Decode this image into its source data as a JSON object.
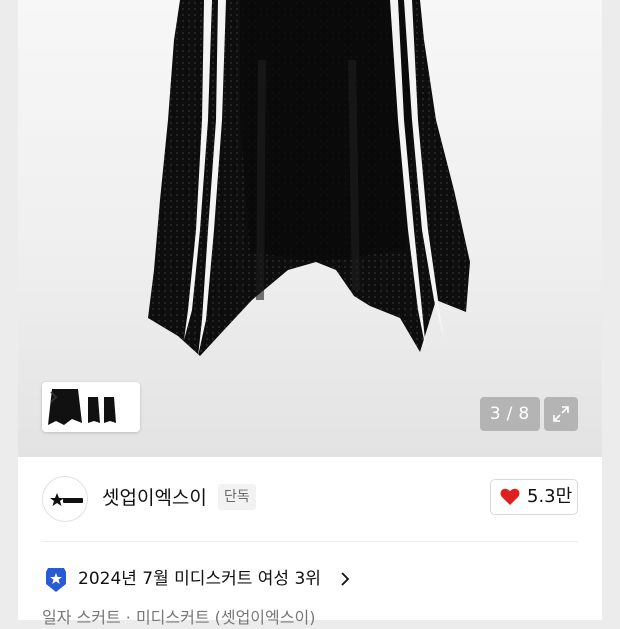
{
  "gallery": {
    "counter_current": "3",
    "counter_separator": "/",
    "counter_total": "8",
    "thumbnails_icon": "skirt-thumbnails",
    "expand_icon": "expand-arrows-icon"
  },
  "brand": {
    "name": "셋업이엑스이",
    "exclusive_label": "단독",
    "logo_icon": "star-logo-icon"
  },
  "like": {
    "count": "5.3만",
    "icon": "heart-icon",
    "color": "#e02020"
  },
  "ranking": {
    "text": "2024년 7월 미디스커트 여성 3위",
    "icon": "ranking-badge-icon",
    "accent": "#2a5bd7"
  },
  "category_path": "일자 스커트 · 미디스커트 (셋업이엑스이)"
}
